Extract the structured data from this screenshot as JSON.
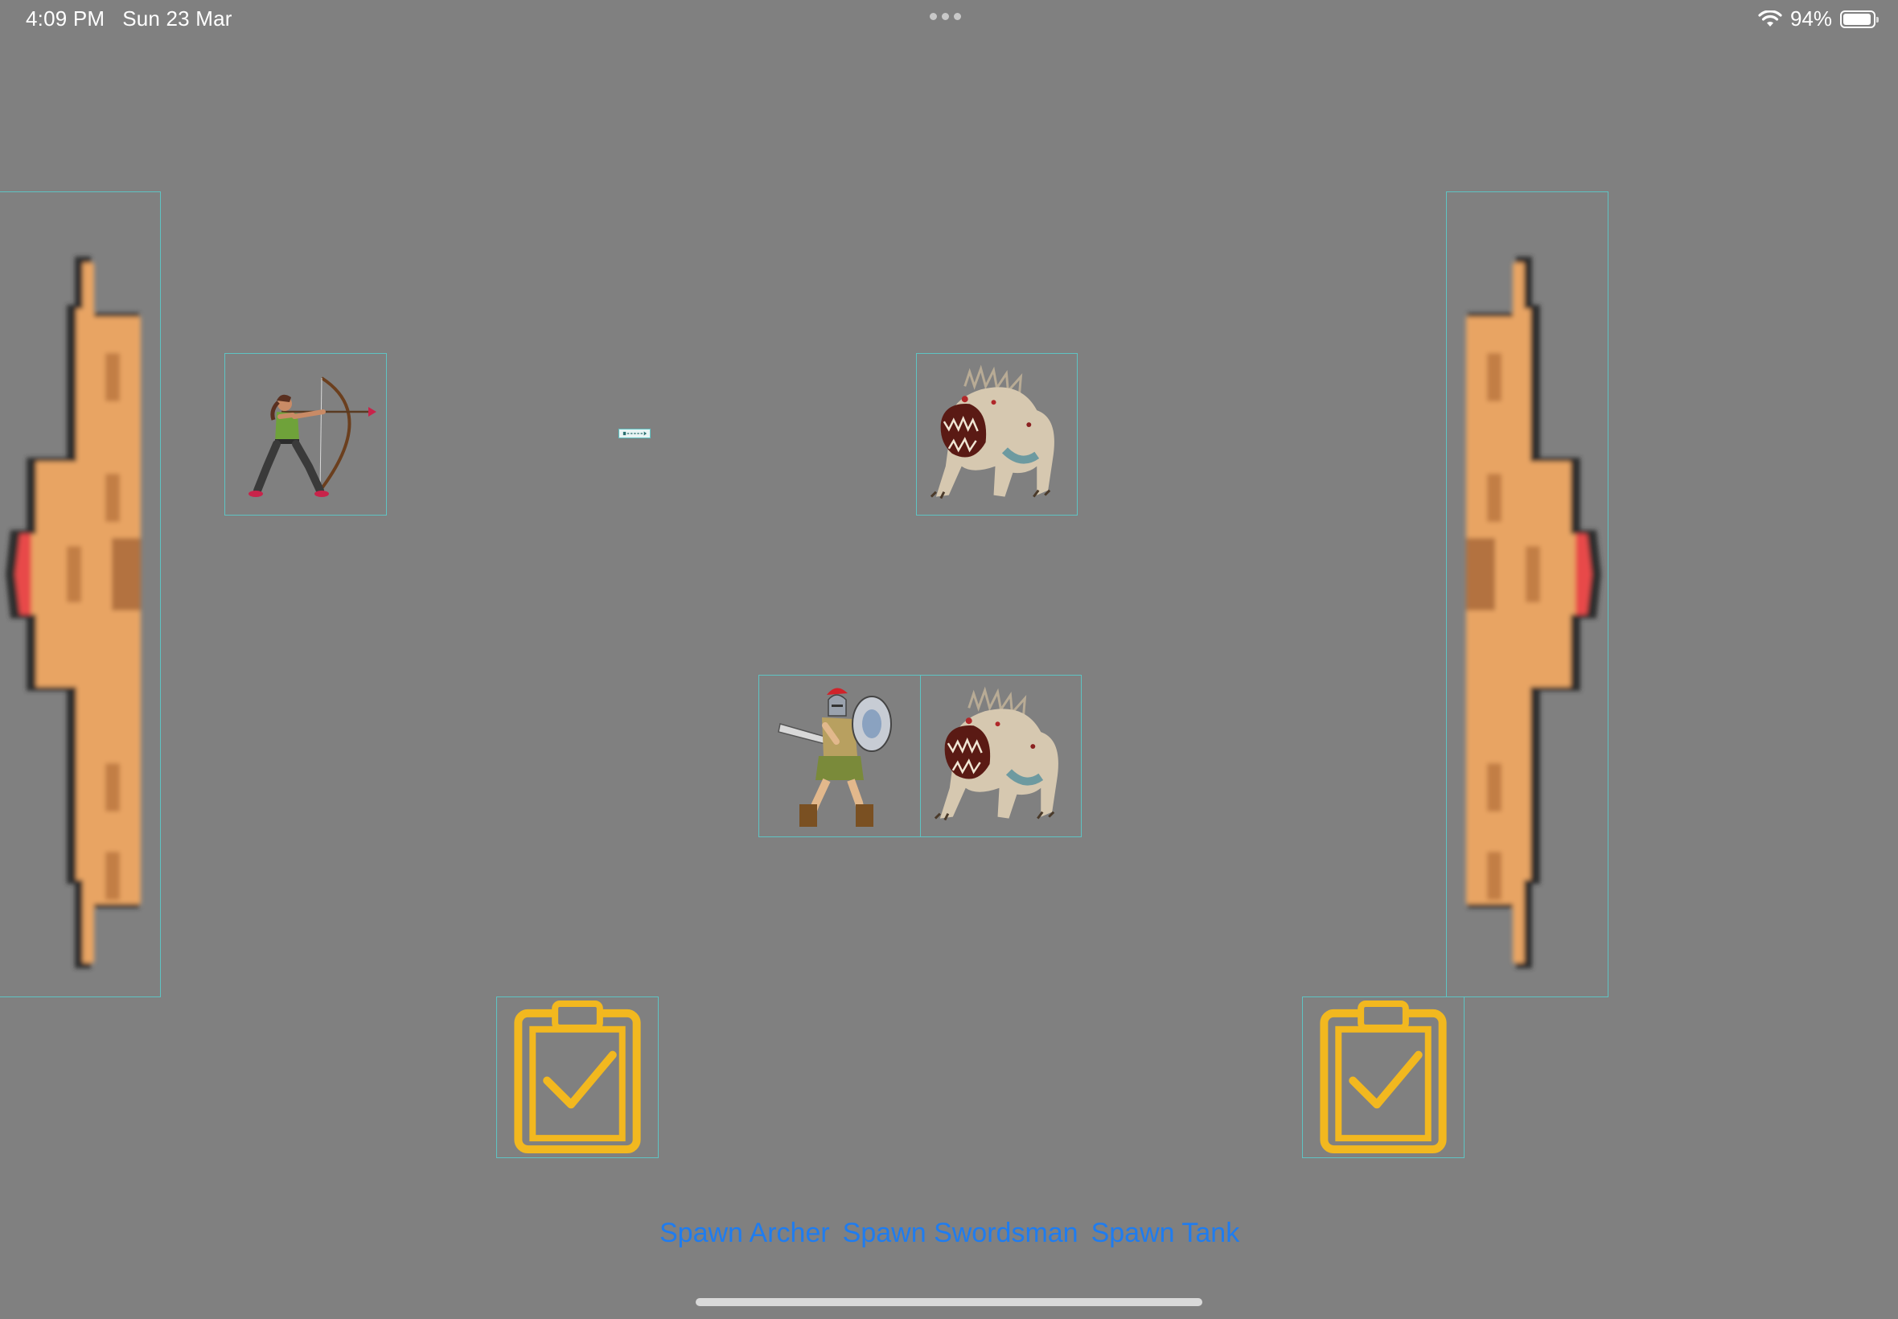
{
  "status_bar": {
    "time": "4:09 PM",
    "date": "Sun 23 Mar",
    "battery_text": "94%",
    "battery_level": 0.94
  },
  "game": {
    "player_castle": {
      "icon": "castle-icon",
      "facing": "left",
      "color": "#e8a464"
    },
    "enemy_castle": {
      "icon": "castle-icon",
      "facing": "right",
      "color": "#e8a464"
    },
    "units": [
      {
        "type": "archer",
        "team": "player",
        "icon": "archer-icon"
      },
      {
        "type": "monster",
        "team": "enemy",
        "icon": "monster-icon"
      },
      {
        "type": "swordsman",
        "team": "player",
        "icon": "swordsman-icon"
      },
      {
        "type": "monster",
        "team": "enemy",
        "icon": "monster-icon"
      }
    ],
    "projectile": {
      "icon": "arrow-projectile-icon"
    },
    "checkpoints": [
      {
        "icon": "clipboard-check-icon",
        "color": "#f2b81f"
      },
      {
        "icon": "clipboard-check-icon",
        "color": "#f2b81f"
      }
    ],
    "outline_color": "#5fc3c3"
  },
  "spawn_buttons": {
    "archer": "Spawn Archer",
    "swordsman": "Spawn Swordsman",
    "tank": "Spawn Tank"
  },
  "accent_color": "#1e7cf0"
}
